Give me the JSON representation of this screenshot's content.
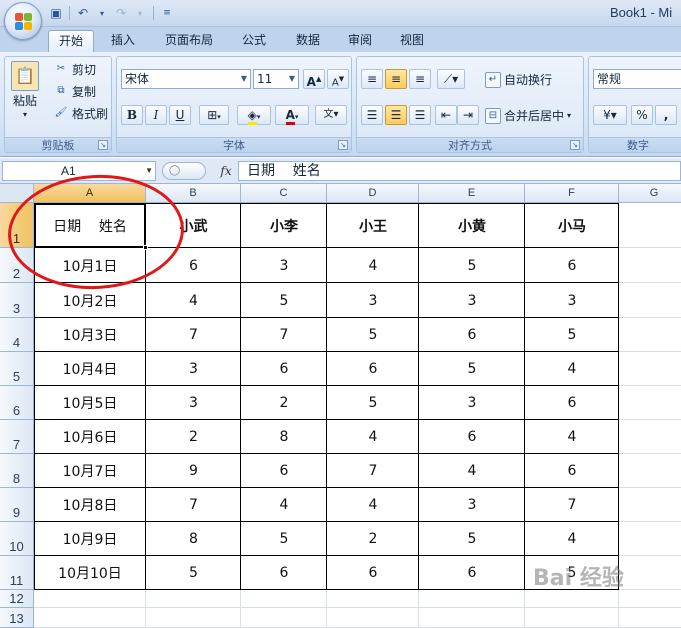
{
  "app": {
    "title": "Book1 - Mi"
  },
  "tabs": [
    {
      "label": "开始",
      "active": true
    },
    {
      "label": "插入"
    },
    {
      "label": "页面布局"
    },
    {
      "label": "公式"
    },
    {
      "label": "数据"
    },
    {
      "label": "审阅"
    },
    {
      "label": "视图"
    }
  ],
  "ribbon": {
    "clipboard": {
      "label": "剪贴板",
      "paste": "粘贴",
      "cut": "剪切",
      "copy": "复制",
      "format_painter": "格式刷"
    },
    "font": {
      "label": "字体",
      "font_name": "宋体",
      "font_size": "11",
      "bold": "B",
      "italic": "I",
      "underline": "U",
      "grow": "A",
      "shrink": "A",
      "font_color_glyph": "A",
      "phonetic": "wén 变"
    },
    "alignment": {
      "label": "对齐方式",
      "wrap_text": "自动换行",
      "merge_center": "合并后居中"
    },
    "number": {
      "label": "数字",
      "format": "常规",
      "percent": "%",
      "comma": ","
    }
  },
  "formula_bar": {
    "name_box": "A1",
    "fx": "fx",
    "content": "日期    姓名"
  },
  "sheet": {
    "columns": [
      "A",
      "B",
      "C",
      "D",
      "E",
      "F",
      "G"
    ],
    "rows": [
      "1",
      "2",
      "3",
      "4",
      "5",
      "6",
      "7",
      "8",
      "9",
      "10",
      "11",
      "12",
      "13"
    ],
    "header_row": [
      "日期    姓名",
      "小武",
      "小李",
      "小王",
      "小黄",
      "小马"
    ],
    "data": [
      [
        "10月1日",
        "6",
        "3",
        "4",
        "5",
        "6"
      ],
      [
        "10月2日",
        "4",
        "5",
        "3",
        "3",
        "3"
      ],
      [
        "10月3日",
        "7",
        "7",
        "5",
        "6",
        "5"
      ],
      [
        "10月4日",
        "3",
        "6",
        "6",
        "5",
        "4"
      ],
      [
        "10月5日",
        "3",
        "2",
        "5",
        "3",
        "6"
      ],
      [
        "10月6日",
        "2",
        "8",
        "4",
        "6",
        "4"
      ],
      [
        "10月7日",
        "9",
        "6",
        "7",
        "4",
        "6"
      ],
      [
        "10月8日",
        "7",
        "4",
        "4",
        "3",
        "7"
      ],
      [
        "10月9日",
        "8",
        "5",
        "2",
        "5",
        "4"
      ],
      [
        "10月10日",
        "5",
        "6",
        "6",
        "6",
        "5"
      ]
    ]
  },
  "watermark": "Bai 经验",
  "colors": {
    "annotation_circle": "#e01818",
    "selected_header": "#f1c15f"
  }
}
